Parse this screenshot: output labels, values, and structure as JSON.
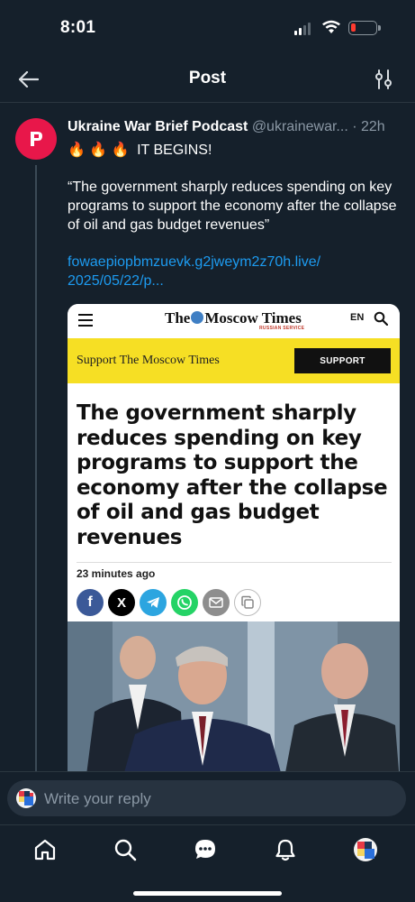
{
  "status": {
    "time": "8:01"
  },
  "header": {
    "title": "Post"
  },
  "post": {
    "author": "Ukraine War Brief Podcast",
    "handle": "@ukrainewar...",
    "time": "· 22h",
    "flames": "🔥 🔥 🔥",
    "headline_text": "IT BEGINS!",
    "quote": "“The government sharply reduces spending on key programs to support the economy after the collapse of oil and gas budget revenues”",
    "link_line1": "fowaepiopbmzuevk.g2jweym2z70h.live/",
    "link_line2": "2025/05/22/p..."
  },
  "card": {
    "logo_the": "The",
    "logo_name": "Moscow Times",
    "logo_sub": "RUSSIAN SERVICE",
    "lang": "EN",
    "support_text": "Support The Moscow Times",
    "support_button": "SUPPORT",
    "headline": "The government sharply reduces spending on key programs to support the economy after the collapse of oil and gas budget revenues",
    "time_ago": "23 minutes ago",
    "share_fb": "f",
    "share_x": "X"
  },
  "reply": {
    "placeholder": "Write your reply"
  },
  "colors": {
    "background": "#15202b",
    "accent": "#1d9bf0",
    "avatar": "#e8174a",
    "support": "#f6df24"
  }
}
